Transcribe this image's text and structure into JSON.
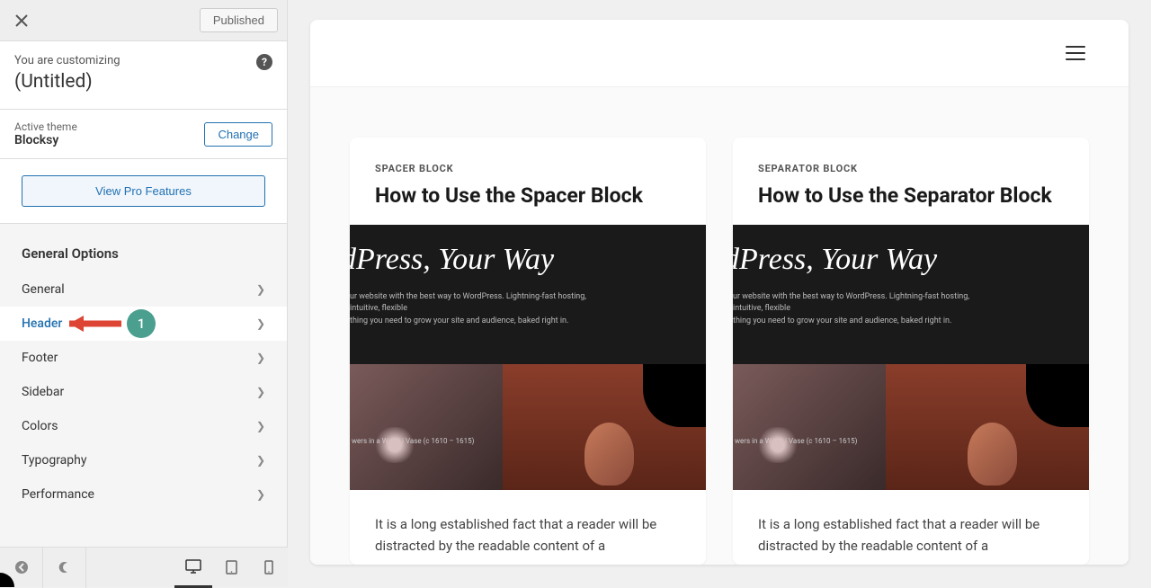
{
  "topbar": {
    "published": "Published"
  },
  "customizing": {
    "label": "You are customizing",
    "title": "(Untitled)"
  },
  "theme": {
    "label": "Active theme",
    "name": "Blocksy",
    "change": "Change"
  },
  "pro": {
    "button": "View Pro Features"
  },
  "general_heading": "General Options",
  "nav": [
    {
      "label": "General",
      "active": false
    },
    {
      "label": "Header",
      "active": true
    },
    {
      "label": "Footer",
      "active": false
    },
    {
      "label": "Sidebar",
      "active": false
    },
    {
      "label": "Colors",
      "active": false
    },
    {
      "label": "Typography",
      "active": false
    },
    {
      "label": "Performance",
      "active": false
    }
  ],
  "annotation_badge": "1",
  "preview": {
    "cards": [
      {
        "category": "SPACER BLOCK",
        "title": "How to Use the Spacer Block",
        "image_headline": "dPress, Your Way",
        "image_sub1": "ur website with the best way to WordPress. Lightning-fast hosting, intuitive, flexible",
        "image_sub2": "thing you need to grow your site and audience, baked right in.",
        "image_flowers": "wers in a Wan-Li Vase\n(c 1610 – 1615)",
        "body": "It is a long established fact that a reader will be distracted by the readable content of a"
      },
      {
        "category": "SEPARATOR BLOCK",
        "title": "How to Use the Separator Block",
        "image_headline": "dPress, Your Way",
        "image_sub1": "ur website with the best way to WordPress. Lightning-fast hosting, intuitive, flexible",
        "image_sub2": "thing you need to grow your site and audience, baked right in.",
        "image_flowers": "wers in a Wan-Li Vase\n(c 1610 – 1615)",
        "body": "It is a long established fact that a reader will be distracted by the readable content of a"
      }
    ]
  }
}
